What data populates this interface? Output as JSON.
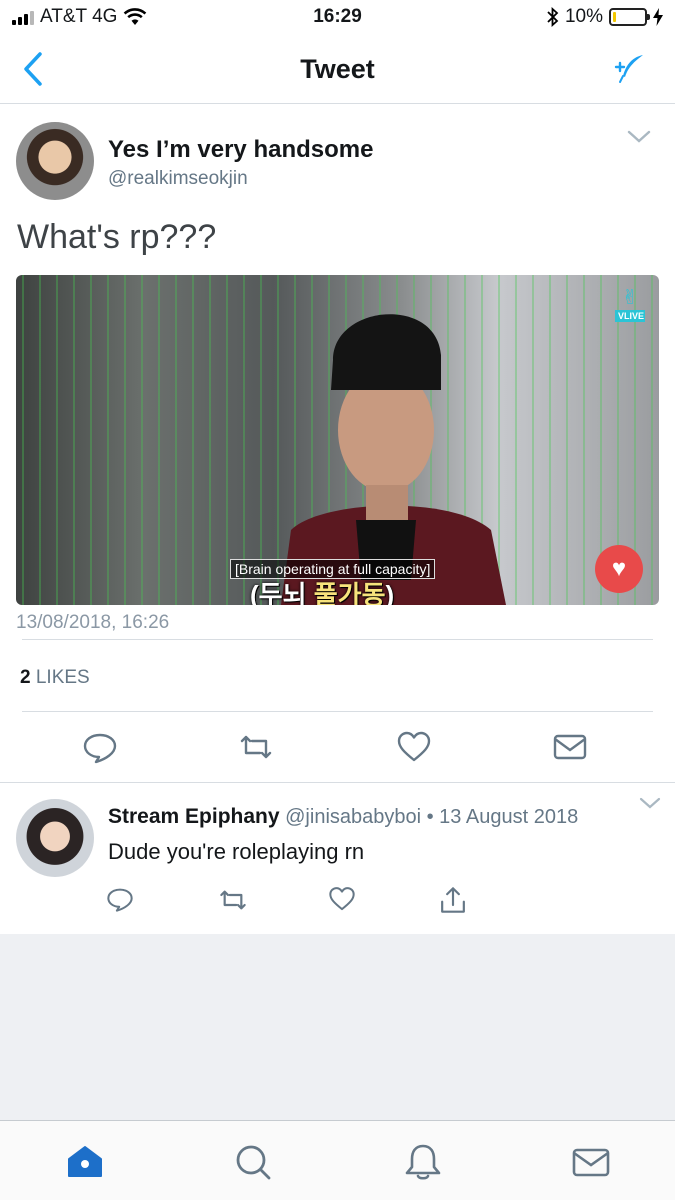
{
  "status_bar": {
    "carrier": "AT&T 4G",
    "time": "16:29",
    "battery": "10%",
    "battery_level": 0.1,
    "icons": [
      "signal-icon",
      "wifi-icon",
      "bluetooth-icon",
      "battery-icon",
      "charging-icon"
    ]
  },
  "nav": {
    "title": "Tweet",
    "icons": [
      "back-chevron-icon",
      "compose-feather-icon"
    ]
  },
  "tweet": {
    "display_name": "Yes I’m very handsome",
    "handle": "@realkimseokjin",
    "text": "What's rp???",
    "media": {
      "subtitle": "[Brain operating at full capacity]",
      "korean_caption_1": "(두뇌 ",
      "korean_caption_2": "풀가동",
      "korean_caption_3": ")",
      "watermark": "VLIVE"
    },
    "timestamp": "13/08/2018, 16:26",
    "likes_count": "2",
    "likes_label": " LIKES",
    "actions": [
      "reply-icon",
      "retweet-icon",
      "like-icon",
      "message-icon"
    ]
  },
  "reply": {
    "name": "Stream Epiphany",
    "handle": "@jinisababyboi",
    "date": " • 13 August 2018",
    "text": "Dude you're roleplaying rn",
    "actions": [
      "reply-icon",
      "retweet-icon",
      "like-icon",
      "share-icon"
    ]
  },
  "tab_bar": {
    "items": [
      "home-icon",
      "search-icon",
      "notifications-icon",
      "messages-icon"
    ]
  },
  "colors": {
    "accent": "#1da1f2",
    "icon_gray": "#657786",
    "text": "#14171a",
    "secondary": "#657786"
  }
}
